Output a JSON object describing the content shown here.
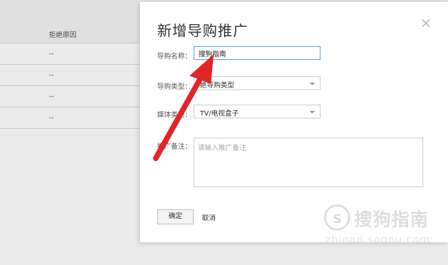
{
  "background_table": {
    "column_header": "拒绝原因",
    "rows": [
      "--",
      "--",
      "--",
      "--"
    ]
  },
  "dialog": {
    "title": "新增导购推广",
    "close_glyph": "×",
    "fields": {
      "name": {
        "label": "导购名称：",
        "value": "搜狗指南"
      },
      "type": {
        "label": "导购类型：",
        "value": "绝导购类型"
      },
      "media": {
        "label": "媒体类型：",
        "value": "TV/电视盒子"
      },
      "remark": {
        "label": "推广备注：",
        "placeholder": "请输入推广备注"
      }
    },
    "confirm_label": "确定",
    "cancel_label": "取消"
  },
  "annotation": {
    "arrow_color": "#e0252b"
  },
  "watermark": {
    "text": "搜狗指南",
    "url": "zhinan.sogou.com"
  },
  "colors": {
    "input_focus": "#5b9bd5"
  }
}
